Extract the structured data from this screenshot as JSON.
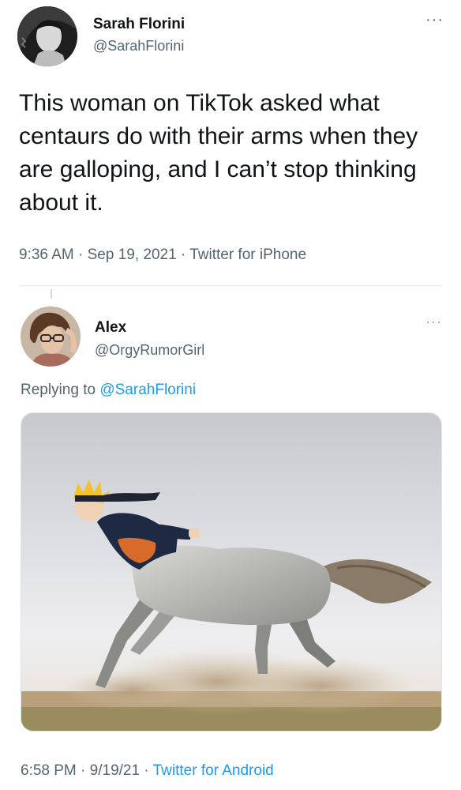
{
  "tweet": {
    "author_name": "Sarah Florini",
    "author_handle": "@SarahFlorini",
    "text": "This woman on TikTok asked what centaurs do with their arms when they are galloping, and I can’t stop thinking about it.",
    "time": "9:36 AM",
    "date": "Sep 19, 2021",
    "source": "Twitter for iPhone",
    "separator": "·",
    "more_icon": "more-options-icon"
  },
  "reply": {
    "author_name": "Alex",
    "author_handle": "@OrgyRumorGirl",
    "replying_prefix": "Replying to",
    "replying_to": "@SarahFlorini",
    "time": "6:58 PM",
    "date": "9/19/21",
    "source": "Twitter for Android",
    "separator": "·",
    "media_description_icon": "centaur-image"
  },
  "colors": {
    "text": "#0f1419",
    "secondary": "#536471",
    "link": "#1d9bf0",
    "divider": "#e6ecf0"
  }
}
